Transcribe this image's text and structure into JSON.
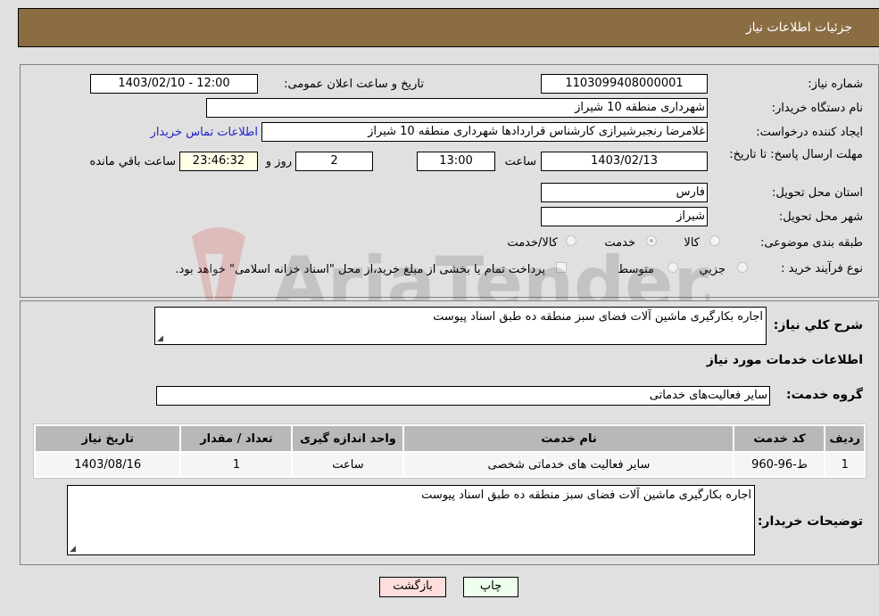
{
  "header": {
    "title": "جزئیات اطلاعات نیاز"
  },
  "form": {
    "need_number_label": "شماره نیاز:",
    "need_number": "1103099408000001",
    "announce_label": "تاریخ و ساعت اعلان عمومی:",
    "announce_value": "1403/02/10 - 12:00",
    "buyer_org_label": "نام دستگاه خریدار:",
    "buyer_org": "شهرداری منطقه 10 شیراز",
    "creator_label": "ایجاد کننده درخواست:",
    "creator": "غلامرضا رنجبرشیرازی کارشناس قراردادها شهرداری منطقه 10 شیراز",
    "buyer_contact_link": "اطلاعات تماس خریدار",
    "deadline_label": "مهلت ارسال پاسخ: تا تاریخ:",
    "deadline_date": "1403/02/13",
    "time_label": "ساعت",
    "deadline_time": "13:00",
    "days_value": "2",
    "days_label": "روز و",
    "remaining_time": "23:46:32",
    "remaining_label": "ساعت باقي مانده",
    "province_label": "استان محل تحویل:",
    "province": "فارس",
    "city_label": "شهر محل تحویل:",
    "city": "شیراز",
    "category_label": "طبقه بندی موضوعی:",
    "category_options": [
      {
        "label": "کالا",
        "checked": false
      },
      {
        "label": "خدمت",
        "checked": true
      },
      {
        "label": "کالا/خدمت",
        "checked": false
      }
    ],
    "purchase_type_label": "نوع فرآیند خرید :",
    "purchase_type_options": [
      {
        "label": "جزیي",
        "checked": false
      },
      {
        "label": "متوسط",
        "checked": false
      }
    ],
    "treasury_checkbox_label": "پرداخت تمام یا بخشی از مبلغ خرید،از محل \"اسناد خزانه اسلامی\" خواهد بود.",
    "treasury_checked": false
  },
  "details": {
    "description_label": "شرح کلي نیاز:",
    "description": "اجاره بکارگیری ماشین آلات فضای سبز منطقه ده طبق اسناد پیوست",
    "services_heading": "اطلاعات خدمات مورد نیاز",
    "service_group_label": "گروه خدمت:",
    "service_group": "سایر فعالیت‌های خدماتی",
    "table": {
      "headers": [
        "ردیف",
        "کد خدمت",
        "نام خدمت",
        "واحد اندازه گیری",
        "تعداد / مقدار",
        "تاریخ نیاز"
      ],
      "rows": [
        [
          "1",
          "ط-96-960",
          "سایر فعالیت های خدماتی شخصی",
          "ساعت",
          "1",
          "1403/08/16"
        ]
      ]
    },
    "buyer_notes_label": "توضیحات خریدار:",
    "buyer_notes": "اجاره بکارگیری ماشین آلات فضای سبز منطقه ده طبق اسناد پیوست"
  },
  "buttons": {
    "print": "چاپ",
    "back": "بازگشت"
  },
  "colors": {
    "header_bg": "#8b6d43",
    "print_bg": "#eeffee",
    "back_bg": "#ffdddd",
    "link": "#2222cc"
  },
  "watermark": {
    "text": "AriaTender.neT"
  }
}
